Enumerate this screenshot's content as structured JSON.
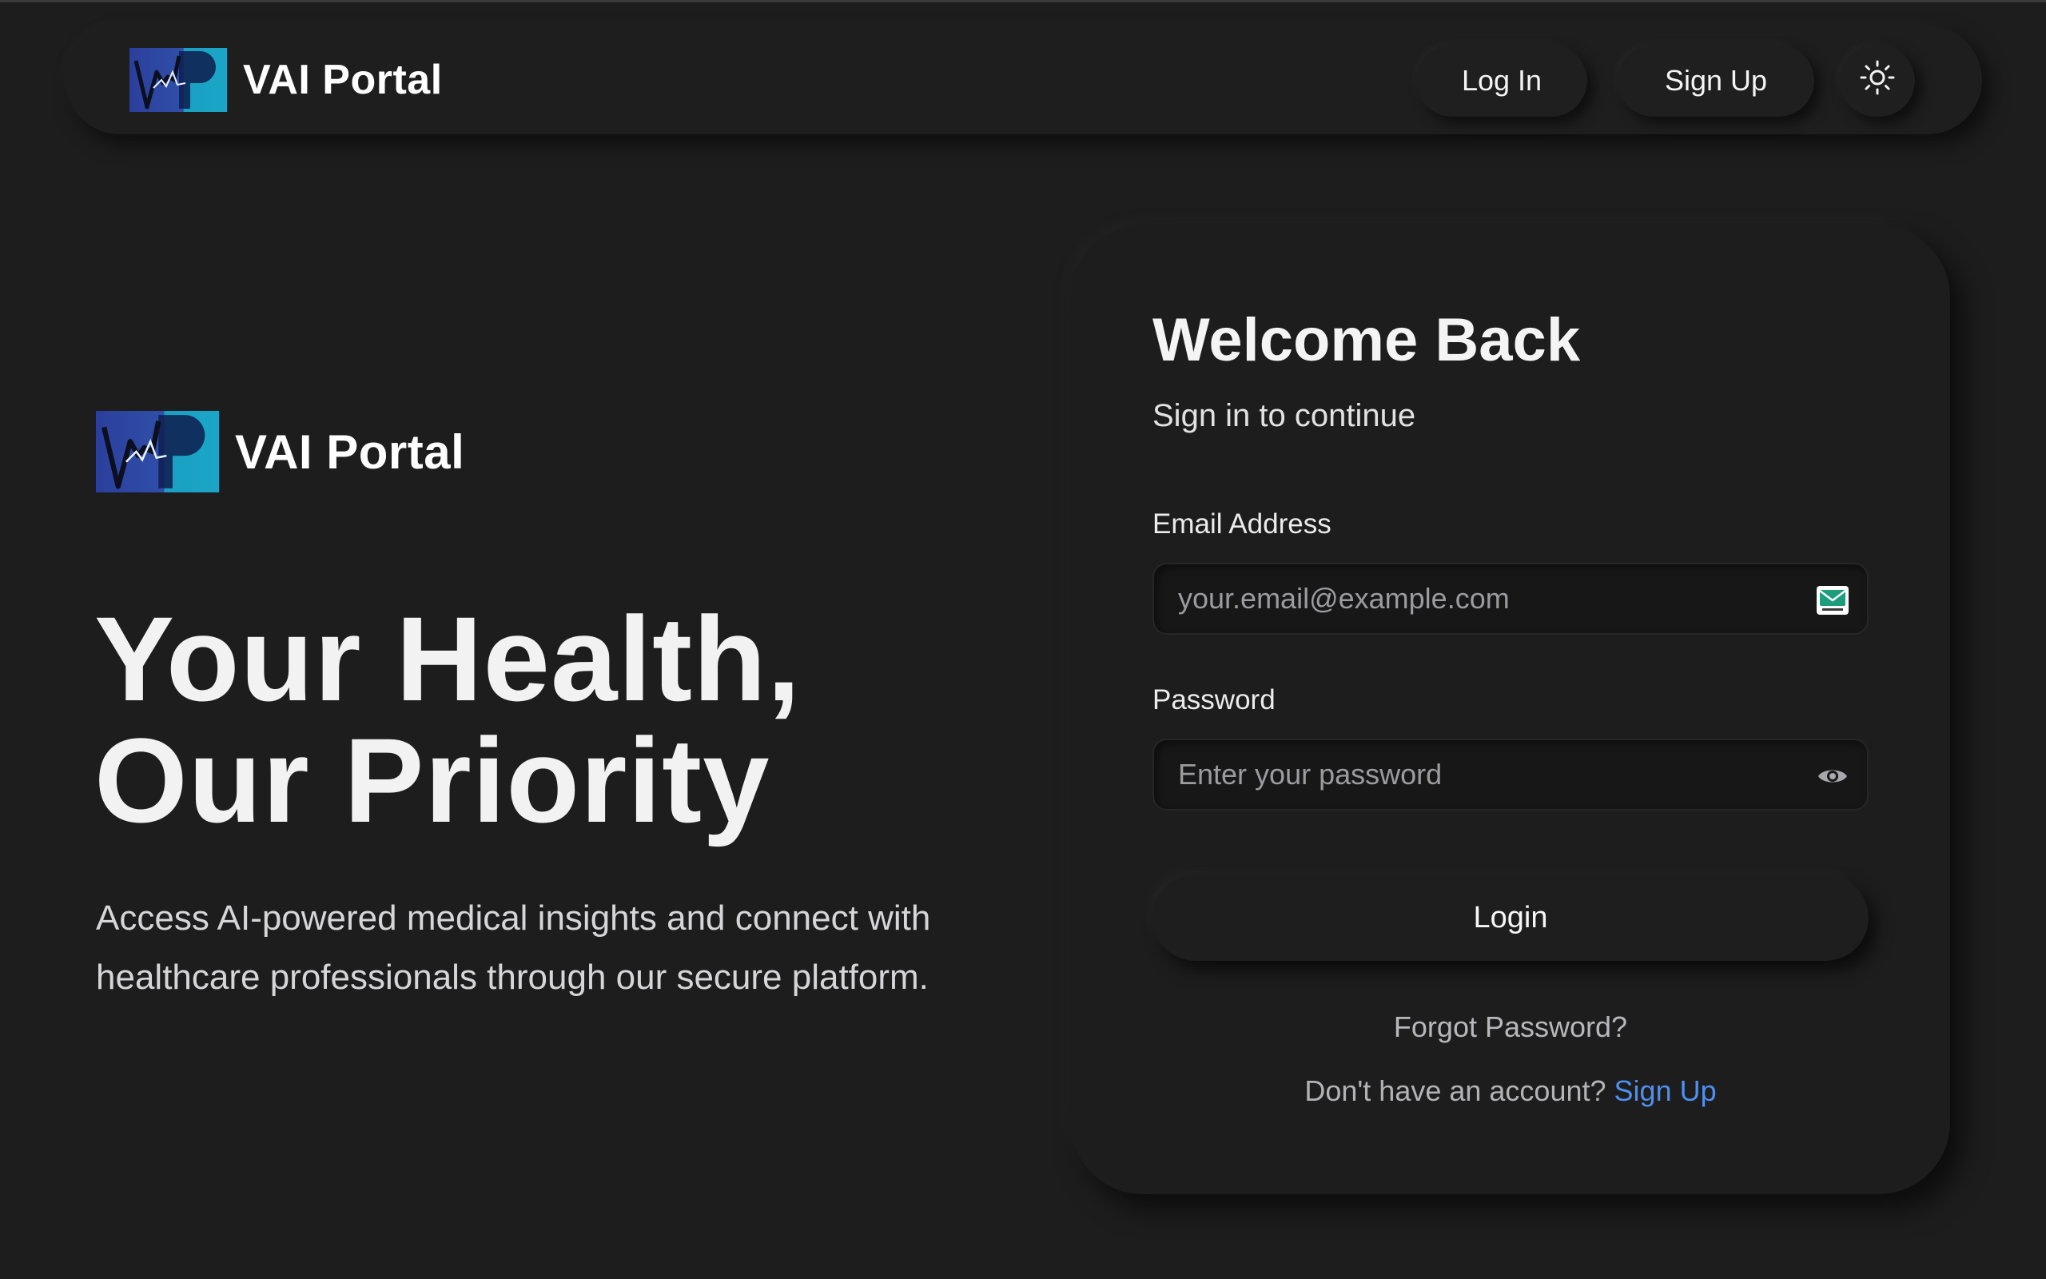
{
  "header": {
    "brand_name": "VAI Portal",
    "login_label": "Log In",
    "signup_label": "Sign Up",
    "theme_icon": "sun-icon"
  },
  "hero": {
    "brand_name": "VAI Portal",
    "title_line1": "Your Health,",
    "title_line2": "Our Priority",
    "description": "Access AI-powered medical insights and connect with healthcare professionals through our secure platform."
  },
  "login_card": {
    "title": "Welcome Back",
    "subtitle": "Sign in to continue",
    "email": {
      "label": "Email Address",
      "placeholder": "your.email@example.com",
      "value": "",
      "icon": "email-icon"
    },
    "password": {
      "label": "Password",
      "placeholder": "Enter your password",
      "value": "",
      "icon": "eye-icon"
    },
    "submit_label": "Login",
    "forgot_label": "Forgot Password?",
    "no_account_text": "Don't have an account?",
    "signup_link": "Sign Up"
  },
  "colors": {
    "background": "#1d1d1e",
    "link": "#4e8ff0",
    "logo_blue": "#2f4fa8",
    "logo_teal": "#1a9fc2"
  }
}
